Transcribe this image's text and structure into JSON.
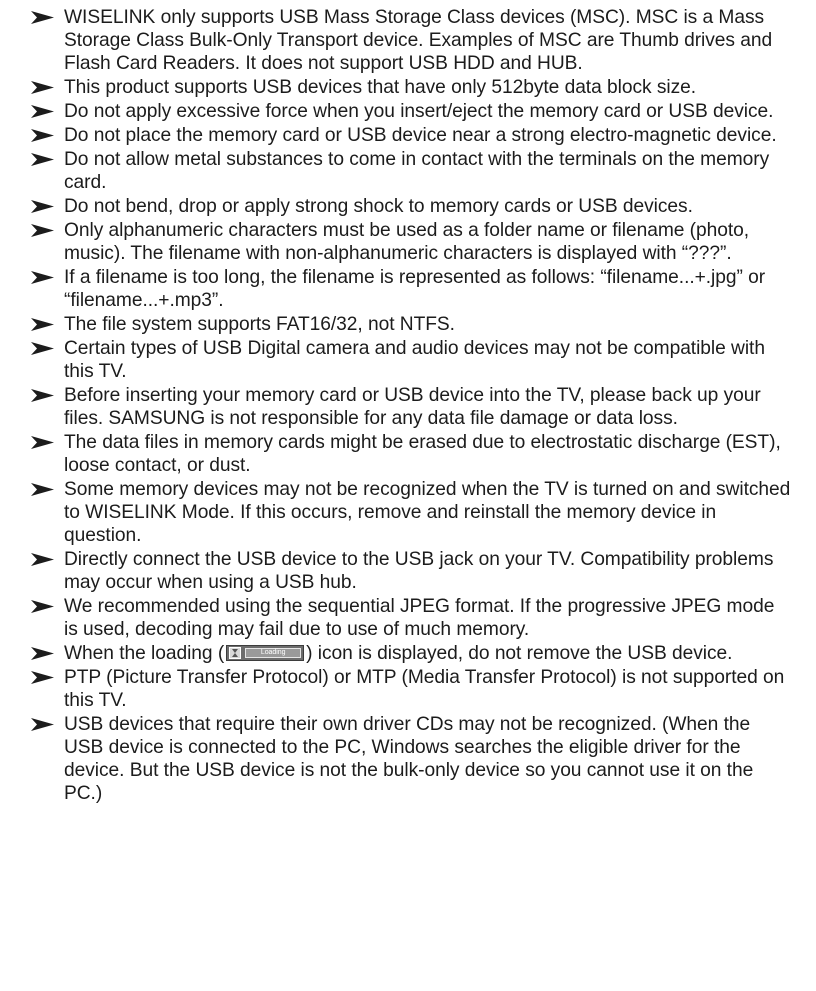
{
  "bullet_icon": "arrowhead-bullet-icon",
  "notes": [
    "WISELINK only supports USB Mass Storage Class devices (MSC). MSC is a Mass Storage Class Bulk-Only Transport device. Examples of MSC are Thumb drives and Flash Card Readers. It does not support USB HDD and HUB.",
    "This product supports USB devices that have only 512byte data block size.",
    "Do not apply excessive force when you insert/eject the memory card or USB device.",
    "Do not place the memory card or USB device near a strong electro-magnetic device.",
    "Do not allow metal substances to come in contact with the terminals on the memory card.",
    "Do not bend, drop or apply strong shock to memory cards or USB devices.",
    "Only alphanumeric characters must be used as a folder name or filename (photo, music). The filename with non-alphanumeric characters is displayed with “???”.",
    "If a filename is too long, the filename is represented as follows: “filename...+.jpg” or “filename...+.mp3”.",
    "The file system supports FAT16/32, not NTFS.",
    "Certain types of USB Digital camera and audio devices may not be compatible with this TV.",
    "Before inserting your memory card or USB device into the TV, please back up your files. SAMSUNG is not responsible for any data file damage or data loss.",
    "The data files in memory cards might be erased due to electrostatic discharge (EST), loose contact, or dust.",
    "Some memory devices may not be recognized when the TV is turned on and switched to WISELINK Mode. If this occurs, remove and reinstall the memory device in question.",
    "Directly connect the USB device to the USB jack on your TV. Compatibility problems may occur when using a USB hub.",
    "We recommended using the sequential JPEG format. If the progressive JPEG mode is used, decoding may fail due to use of much memory."
  ],
  "loading_note": {
    "before": "When the loading (",
    "icon_label": "Loading",
    "after": ") icon is displayed, do not remove the USB device."
  },
  "notes_after": [
    "PTP (Picture Transfer Protocol) or MTP (Media Transfer Protocol) is not supported on this TV.",
    "USB devices that require their own driver CDs may not be recognized. (When the USB device is connected to the PC, Windows searches the eligible driver for the device. But the USB device is not the bulk-only device so you cannot use it on the PC.)"
  ]
}
